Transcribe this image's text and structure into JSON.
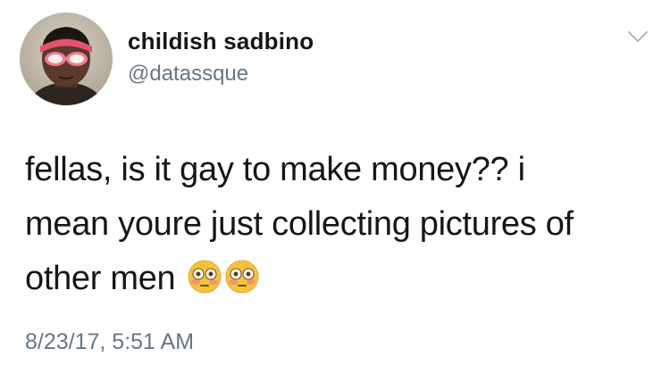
{
  "author": {
    "display_name": "childish sadbino",
    "handle": "@datassque",
    "avatar_icon": "profile-photo-pink-headband-sunglasses"
  },
  "tweet": {
    "lines": [
      "fellas, is it gay to make money?? i",
      "mean youre just collecting pictures of",
      "other men"
    ],
    "emojis": [
      "flushed-face-emoji",
      "flushed-face-emoji"
    ],
    "timestamp": "8/23/17, 5:51 AM"
  },
  "menu": {
    "icon": "chevron-down-icon"
  },
  "colors": {
    "text": "#14171a",
    "secondary": "#657786",
    "chevron": "#aab8c2",
    "headband": "#e8506e"
  }
}
